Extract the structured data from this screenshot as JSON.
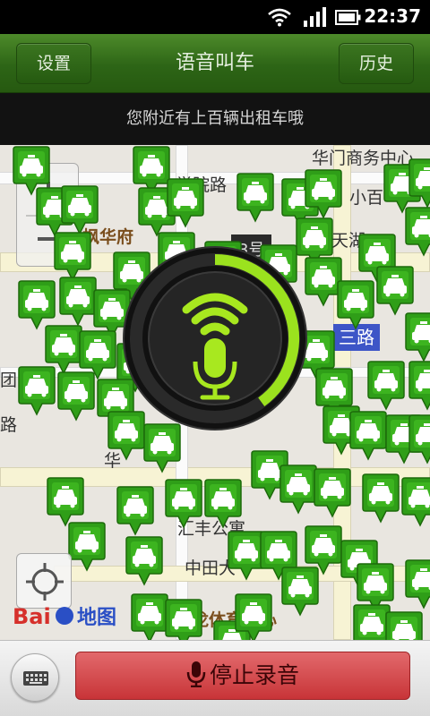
{
  "status_bar": {
    "time": "22:37",
    "icons": [
      "wifi-icon",
      "signal-icon",
      "battery-icon"
    ]
  },
  "header": {
    "left_button": "设置",
    "title": "语音叫车",
    "right_button": "历史"
  },
  "info_bar": {
    "message": "您附近有上百辆出租车哦"
  },
  "map": {
    "labels": [
      "华门商务中心",
      "学院路",
      "小百",
      "枫华府",
      "天湖",
      "3号",
      "华",
      "汇丰公寓",
      "中田大",
      "龙体育中心",
      "团",
      "路"
    ],
    "road_sign": "三路",
    "logo": "Baidu 地图"
  },
  "voice_dial": {
    "progress": 0.4
  },
  "bottom_bar": {
    "stop_button": "停止录音"
  },
  "colors": {
    "title_green": "#2d6516",
    "taxi_green": "#2f9e18",
    "dial_green": "#9be21e",
    "stop_red": "#c83438"
  }
}
